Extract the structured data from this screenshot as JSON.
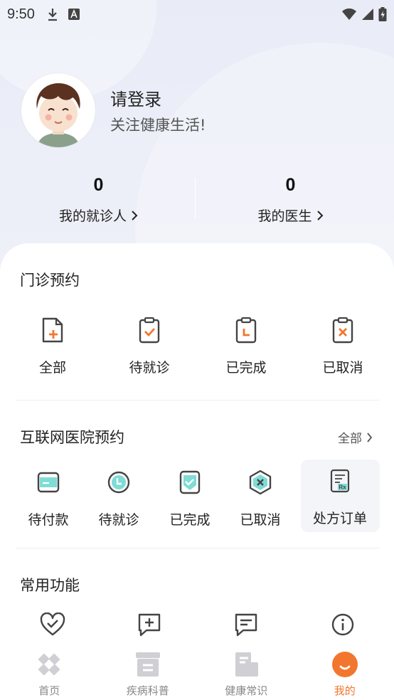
{
  "status_bar": {
    "time": "9:50"
  },
  "profile": {
    "login_title": "请登录",
    "subtitle": "关注健康生活!"
  },
  "stats": [
    {
      "count": "0",
      "label": "我的就诊人"
    },
    {
      "count": "0",
      "label": "我的医生"
    }
  ],
  "outpatient": {
    "title": "门诊预约",
    "items": [
      {
        "label": "全部",
        "icon": "file-plus-icon"
      },
      {
        "label": "待就诊",
        "icon": "clipboard-check-icon"
      },
      {
        "label": "已完成",
        "icon": "clipboard-clock-icon"
      },
      {
        "label": "已取消",
        "icon": "clipboard-x-icon"
      }
    ]
  },
  "internet_hospital": {
    "title": "互联网医院预约",
    "more": "全部",
    "items": [
      {
        "label": "待付款",
        "icon": "card-icon"
      },
      {
        "label": "待就诊",
        "icon": "clock-icon"
      },
      {
        "label": "已完成",
        "icon": "shield-check-icon"
      },
      {
        "label": "已取消",
        "icon": "hexagon-x-icon"
      },
      {
        "label": "处方订单",
        "icon": "prescription-icon"
      }
    ]
  },
  "common": {
    "title": "常用功能",
    "items": [
      {
        "icon": "heart-check-icon"
      },
      {
        "icon": "message-plus-icon"
      },
      {
        "icon": "message-lines-icon"
      },
      {
        "icon": "info-icon"
      }
    ]
  },
  "tabbar": [
    {
      "label": "首页",
      "icon": "home-cross-icon",
      "active": false
    },
    {
      "label": "疾病科普",
      "icon": "archive-icon",
      "active": false
    },
    {
      "label": "健康常识",
      "icon": "document-icon",
      "active": false
    },
    {
      "label": "我的",
      "icon": "smile-icon",
      "active": true
    }
  ],
  "colors": {
    "accent": "#f2762e",
    "teal": "#3cc6c0",
    "icon_gray": "#444444"
  }
}
